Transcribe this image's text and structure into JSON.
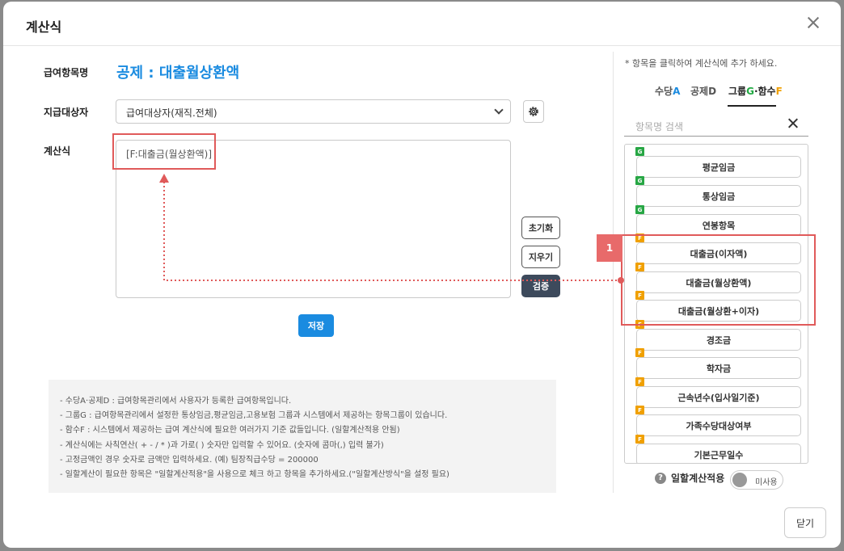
{
  "modal": {
    "title": "계산식",
    "close_label": "닫기"
  },
  "form": {
    "item_name_label": "급여항목명",
    "item_name_value": "공제 : 대출월상환액",
    "target_label": "지급대상자",
    "target_value": "급여대상자(재직.전체)",
    "formula_label": "계산식",
    "formula_value": "[F:대출금(월상환액)]"
  },
  "buttons": {
    "reset": "초기화",
    "erase": "지우기",
    "verify": "검증",
    "save": "저장"
  },
  "notes": [
    "- 수당A·공제D : 급여항목관리에서 사용자가 등록한 급여항목입니다.",
    "- 그룹G : 급여항목관리에서 설정한 통상임금,평균임금,고용보험 그룹과 시스템에서 제공하는 항목그룹이 있습니다.",
    "- 함수F : 시스템에서 제공하는 급여 계산식에 필요한 여러가지 기준 값들입니다. (일할계산적용 안됨)",
    "- 계산식에는 사칙연산( + - / * )과 가로( ) 숫자만 입력할 수 있어요. (숫자에 콤마(,) 입력 불가)",
    "- 고정금액인 경우 숫자로 금액만 입력하세요. (예) 팀장직급수당 = 200000",
    "- 일할계산이 필요한 항목은 \"일할계산적용\"을 사용으로 체크 하고 항목을 추가하세요.(\"일할계산방식\"을 설정 필요)"
  ],
  "panel": {
    "hint": "* 항목을 클릭하여 계산식에 추가 하세요.",
    "tabs": [
      {
        "label": "수당",
        "suffix": "A"
      },
      {
        "label": "공제",
        "suffix": "D"
      },
      {
        "label": "그룹",
        "suffix": "G",
        "sep": "·",
        "label2": "함수",
        "suffix2": "F"
      }
    ],
    "search_placeholder": "항목명 검색",
    "items": [
      {
        "tag": "G",
        "label": "평균임금"
      },
      {
        "tag": "G",
        "label": "통상임금"
      },
      {
        "tag": "G",
        "label": "연봉항목"
      },
      {
        "tag": "F",
        "label": "대출금(이자액)"
      },
      {
        "tag": "F",
        "label": "대출금(월상환액)"
      },
      {
        "tag": "F",
        "label": "대출금(월상환+이자)"
      },
      {
        "tag": "F",
        "label": "경조금"
      },
      {
        "tag": "F",
        "label": "학자금"
      },
      {
        "tag": "F",
        "label": "근속년수(입사일기준)"
      },
      {
        "tag": "F",
        "label": "가족수당대상여부"
      },
      {
        "tag": "F",
        "label": "기본근무일수"
      }
    ],
    "badge": "1",
    "toggle_label": "일할계산적용",
    "toggle_state": "미사용",
    "help_glyph": "?"
  },
  "colors": {
    "accent": "#1a8be0",
    "highlight": "#e05a5a",
    "group_tag": "#28a745",
    "func_tag": "#f0a000"
  }
}
